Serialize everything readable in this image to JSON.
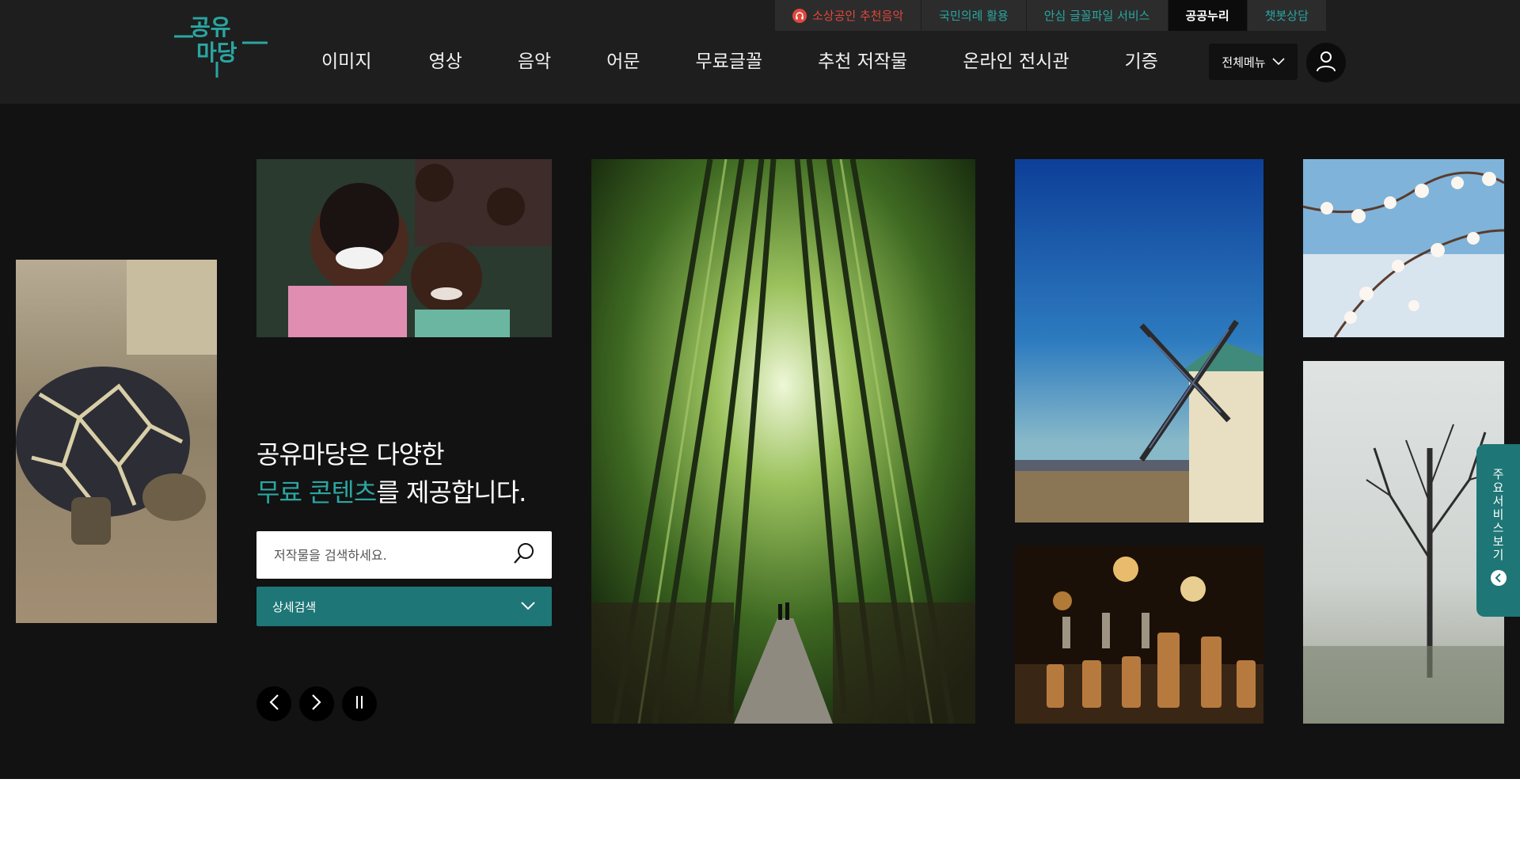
{
  "logo": {
    "text": "공유마당",
    "color": "#2aa6a1"
  },
  "topbar": [
    {
      "label": "소상공인 추천음악",
      "icon": "headphone-icon"
    },
    {
      "label": "국민의례 활용"
    },
    {
      "label": "안심 글꼴파일 서비스"
    },
    {
      "label": "공공누리",
      "active": true
    },
    {
      "label": "챗봇상담"
    }
  ],
  "nav": {
    "items": [
      "이미지",
      "영상",
      "음악",
      "어문",
      "무료글꼴",
      "추천 저작물",
      "온라인 전시관",
      "기증"
    ],
    "all_menu_label": "전체메뉴"
  },
  "hero": {
    "title_line1": "공유마당은 다양한",
    "title_accent": "무료 콘텐츠",
    "title_line2_rest": "를 제공합니다.",
    "search_placeholder": "저작물을 검색하세요.",
    "advanced_label": "상세검색",
    "side_tab_label": "주요서비스보기"
  },
  "photos": [
    {
      "name": "turtle-photo",
      "subject": "star tortoise"
    },
    {
      "name": "children-photo",
      "subject": "smiling children"
    },
    {
      "name": "bamboo-forest-photo",
      "subject": "bamboo forest path"
    },
    {
      "name": "windmill-photo",
      "subject": "windmill under blue sky"
    },
    {
      "name": "cherry-blossom-photo",
      "subject": "cherry blossoms"
    },
    {
      "name": "chess-photo",
      "subject": "chess pieces"
    },
    {
      "name": "misty-tree-photo",
      "subject": "bare tree in mist"
    }
  ],
  "colors": {
    "accent": "#2aa6a1",
    "accent_dark": "#1e7676",
    "header_bg": "#1e1e1e",
    "hero_bg": "#121212",
    "alert": "#e0483d"
  }
}
